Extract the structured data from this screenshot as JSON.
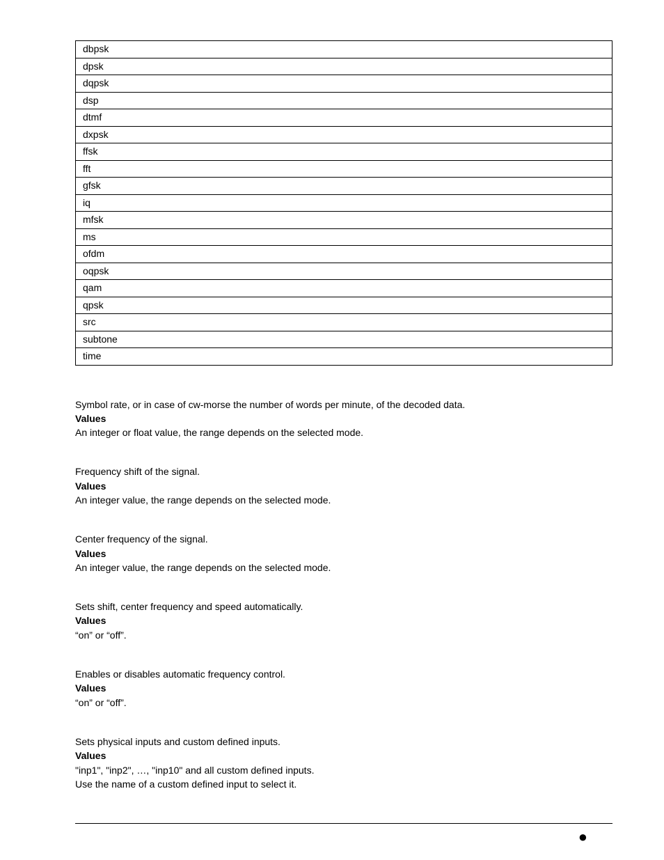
{
  "modes": [
    "dbpsk",
    "dpsk",
    "dqpsk",
    "dsp",
    "dtmf",
    "dxpsk",
    "ffsk",
    "fft",
    "gfsk",
    "iq",
    "mfsk",
    "ms",
    "ofdm",
    "oqpsk",
    "qam",
    "qpsk",
    "src",
    "subtone",
    "time"
  ],
  "sections": [
    {
      "desc": "Symbol rate, or in case of cw-morse the number of words per minute, of the decoded data.",
      "values_label": "Values",
      "values_text": "An integer or float value, the range depends on the selected mode."
    },
    {
      "desc": "Frequency shift of the signal.",
      "values_label": "Values",
      "values_text": "An integer value, the range depends on the selected mode."
    },
    {
      "desc": "Center frequency of the signal.",
      "values_label": "Values",
      "values_text": "An integer value, the range depends on the selected mode."
    },
    {
      "desc": "Sets shift, center frequency and speed automatically.",
      "values_label": "Values",
      "values_text": "“on” or “off”."
    },
    {
      "desc": "Enables or disables automatic frequency control.",
      "values_label": "Values",
      "values_text": "“on” or “off”."
    },
    {
      "desc": "Sets physical inputs and custom defined inputs.",
      "values_label": "Values",
      "values_text": "\"inp1\", \"inp2\", …, \"inp10\" and all custom defined inputs.\nUse the name of a custom defined input to select it."
    }
  ],
  "footer_dot": "●"
}
